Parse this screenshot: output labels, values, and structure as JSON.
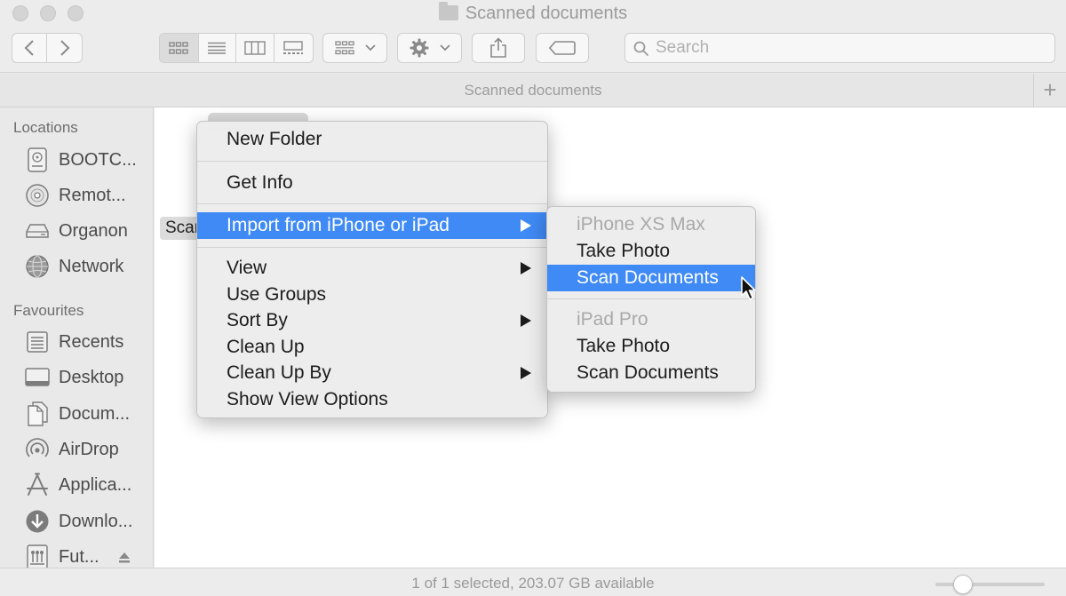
{
  "window": {
    "title": "Scanned documents",
    "path_title": "Scanned documents",
    "accent": "#3f8af5"
  },
  "toolbar": {
    "back_icon": "chevron-left-icon",
    "forward_icon": "chevron-right-icon",
    "view_modes": [
      "icon-view-icon",
      "list-view-icon",
      "column-view-icon",
      "gallery-view-icon"
    ],
    "active_view": "icon-view",
    "group_icon": "group-by-icon",
    "action_icon": "gear-icon",
    "share_icon": "share-icon",
    "tags_icon": "tag-icon",
    "search_placeholder": "Search"
  },
  "sidebar": {
    "locations_header": "Locations",
    "locations": [
      {
        "label": "BOOTC...",
        "icon": "hard-drive-icon"
      },
      {
        "label": "Remot...",
        "icon": "optical-disc-icon"
      },
      {
        "label": "Organon",
        "icon": "external-drive-icon"
      },
      {
        "label": "Network",
        "icon": "globe-icon"
      }
    ],
    "favourites_header": "Favourites",
    "favourites": [
      {
        "label": "Recents",
        "icon": "recents-icon"
      },
      {
        "label": "Desktop",
        "icon": "desktop-icon"
      },
      {
        "label": "Docum...",
        "icon": "documents-icon"
      },
      {
        "label": "AirDrop",
        "icon": "airdrop-icon"
      },
      {
        "label": "Applica...",
        "icon": "applications-icon"
      },
      {
        "label": "Downlo...",
        "icon": "downloads-icon"
      },
      {
        "label": "Fut...",
        "icon": "network-volume-icon"
      }
    ]
  },
  "content": {
    "file_label": "Scan"
  },
  "context_menu": {
    "items": [
      {
        "label": "New Folder"
      },
      {
        "label": "Get Info"
      },
      {
        "label": "Import from iPhone or iPad",
        "submenu": true,
        "highlighted": true
      },
      {
        "label": "View",
        "submenu": true
      },
      {
        "label": "Use Groups"
      },
      {
        "label": "Sort By",
        "submenu": true
      },
      {
        "label": "Clean Up"
      },
      {
        "label": "Clean Up By",
        "submenu": true
      },
      {
        "label": "Show View Options"
      }
    ]
  },
  "submenu": {
    "items": [
      {
        "label": "iPhone XS Max",
        "disabled": true
      },
      {
        "label": "Take Photo"
      },
      {
        "label": "Scan Documents",
        "highlighted": true
      },
      {
        "label": "iPad Pro",
        "disabled": true
      },
      {
        "label": "Take Photo"
      },
      {
        "label": "Scan Documents"
      }
    ]
  },
  "statusbar": {
    "text": "1 of 1 selected, 203.07 GB available",
    "zoom_level": 0.25
  }
}
